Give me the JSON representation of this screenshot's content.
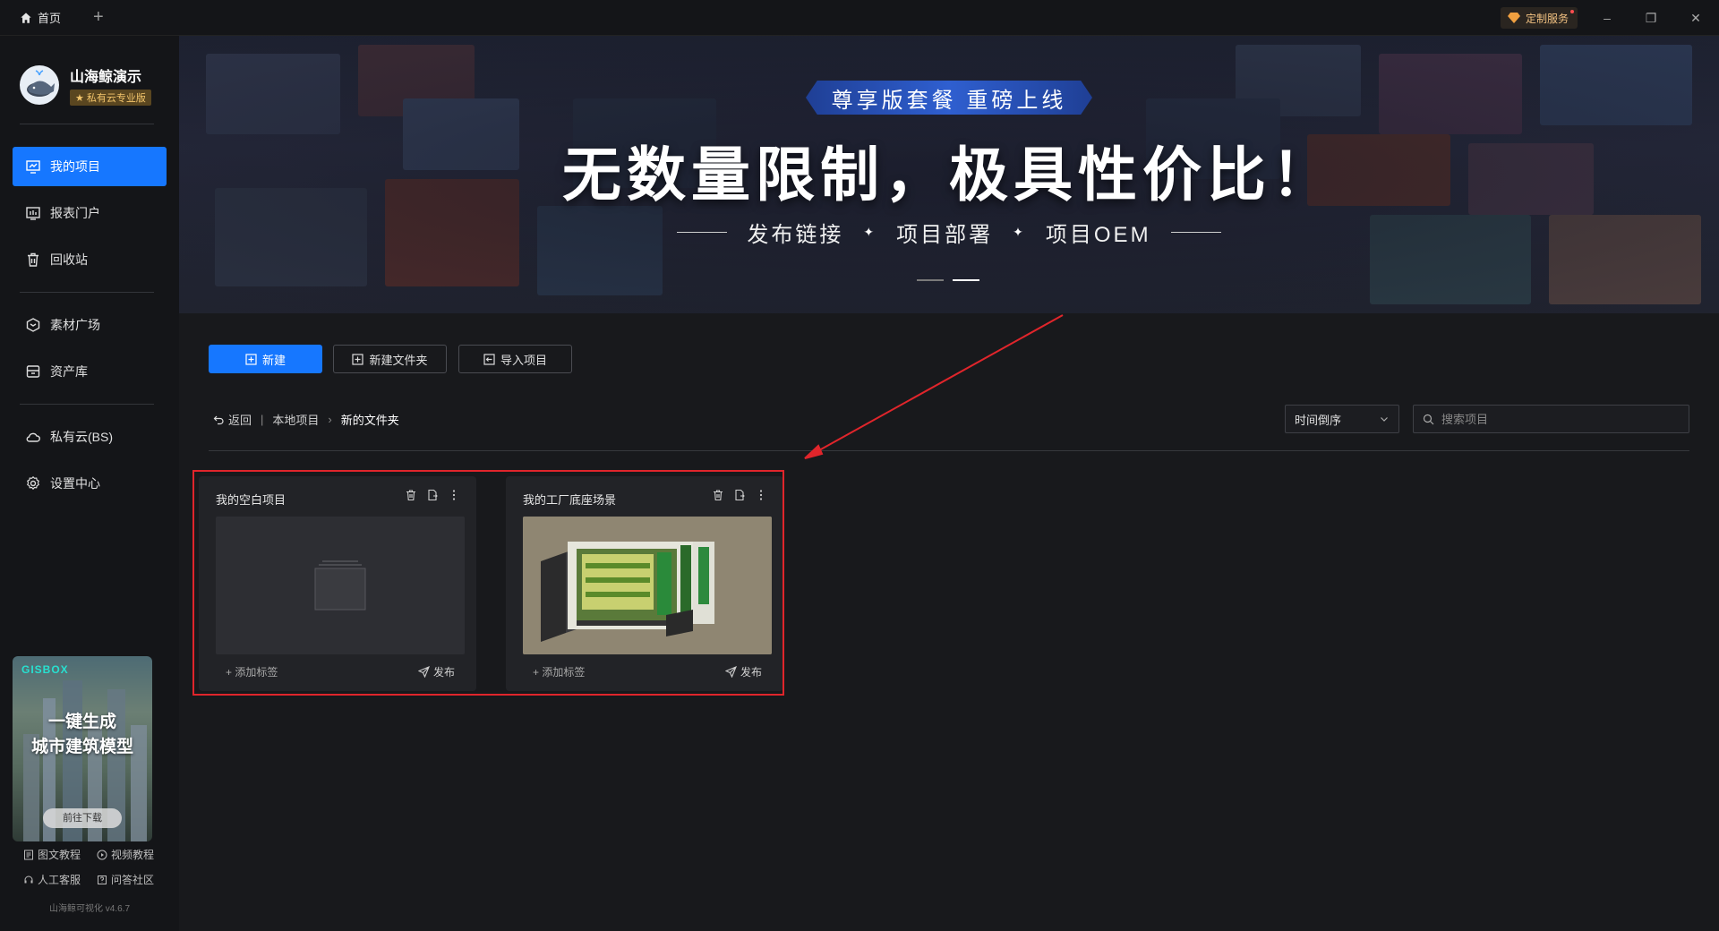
{
  "titlebar": {
    "home_tab": "首页",
    "add_tab": "+",
    "custom_service": "定制服务",
    "minimize": "–",
    "restore": "❐",
    "close": "✕"
  },
  "sidebar": {
    "brand_name": "山海鲸演示",
    "brand_badge": "★ 私有云专业版",
    "items": [
      {
        "label": "我的项目",
        "icon": "project-icon",
        "active": true
      },
      {
        "label": "报表门户",
        "icon": "report-icon",
        "active": false
      },
      {
        "label": "回收站",
        "icon": "trash-icon",
        "active": false
      },
      {
        "label": "素材广场",
        "icon": "material-icon",
        "active": false
      },
      {
        "label": "资产库",
        "icon": "asset-icon",
        "active": false
      },
      {
        "label": "私有云(BS)",
        "icon": "cloud-icon",
        "active": false
      },
      {
        "label": "设置中心",
        "icon": "settings-icon",
        "active": false
      }
    ],
    "promo": {
      "logo": "GISBOX",
      "title_line1": "一键生成",
      "title_line2": "城市建筑模型",
      "button": "前往下载"
    },
    "help": {
      "doc_tutorial": "图文教程",
      "video_tutorial": "视频教程",
      "support": "人工客服",
      "community": "问答社区"
    },
    "version": "山海鲸可视化 v4.6.7"
  },
  "banner": {
    "ribbon": "尊享版套餐 重磅上线",
    "headline": "无数量限制，极具性价比！",
    "features": [
      "发布链接",
      "项目部署",
      "项目OEM"
    ]
  },
  "toolbar": {
    "new": "新建",
    "new_folder": "新建文件夹",
    "import": "导入项目"
  },
  "breadcrumb": {
    "back": "返回",
    "local": "本地项目",
    "current": "新的文件夹"
  },
  "sort": {
    "selected": "时间倒序"
  },
  "search": {
    "placeholder": "搜索项目"
  },
  "projects": [
    {
      "title": "我的空白项目",
      "add_tag": "+ 添加标签",
      "publish": "发布"
    },
    {
      "title": "我的工厂底座场景",
      "add_tag": "+ 添加标签",
      "publish": "发布"
    }
  ],
  "colors": {
    "accent": "#1677ff",
    "highlight": "#e0252b",
    "badge": "#f2c46b"
  }
}
